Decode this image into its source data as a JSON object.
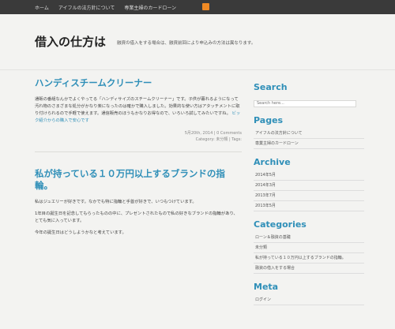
{
  "topbar": {
    "nav": [
      "ホーム",
      "アイフルの法方針について",
      "専業主婦のカードローン"
    ]
  },
  "header": {
    "title": "借入の仕方は",
    "tagline": "融資の借入をする場合は、融資前回により申込みの方法は異なります。"
  },
  "posts": [
    {
      "title": "ハンディスチームクリーナー",
      "body": "通販の番組なんかでよくやってる「ハンディサイズのスチームクリーナー」です。子供が暮れるようになって汚れ物のさまざまな処分がかなり楽になったのは確かで購入しました。効果的な使い方はアタッチメントに取り付けられるので手軽で使えます。通信販売のほうもかなりお得なので、いろいろ試してみたいですね。",
      "link_text": "ビック紹介からの購入で安心です",
      "date": "5月20th, 2014 | 0 Comments",
      "category": "Category: 未分類 | Tags:"
    },
    {
      "title": "私が持っている１０万円以上するブランドの指輪。",
      "body1": "私はジュエリーが好きです。なかでも特に指輪と手首が好きで、いつもつけています。",
      "body2": "1年目の誕生日を記念してもらったものの中に、プレゼントされたもので私の好きなブランドの指輪があり、とても気に入っています。",
      "body3": "今年の誕生日はどうしようかなと考えています。"
    }
  ],
  "sidebar": {
    "search_title": "Search",
    "search_placeholder": "Search here...",
    "pages_title": "Pages",
    "pages": [
      "アイフルの法方針について",
      "専業主婦のカードローン"
    ],
    "archive_title": "Archive",
    "archive": [
      "2014年5月",
      "2014年3月",
      "2013年7月",
      "2013年5月"
    ],
    "categories_title": "Categories",
    "categories": [
      "ローン＆融資の基礎",
      "未分類",
      "私が持っている１０万円以上するブランドの指輪。",
      "融資の借入をする場合"
    ],
    "meta_title": "Meta",
    "meta": [
      "ログイン"
    ]
  }
}
